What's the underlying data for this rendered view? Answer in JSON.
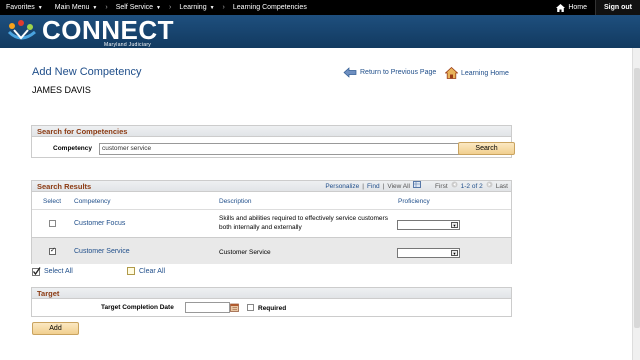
{
  "nav": {
    "favorites": "Favorites",
    "main_menu": "Main Menu",
    "crumb1": "Self Service",
    "crumb2": "Learning",
    "crumb3": "Learning Competencies",
    "sep": "›",
    "home": "Home",
    "signout": "Sign out"
  },
  "banner": {
    "title": "CONNECT",
    "subtitle": "Maryland Judiciary"
  },
  "page": {
    "title": "Add New Competency",
    "return_link": "Return to Previous Page",
    "home_link": "Learning Home",
    "user_name": "JAMES DAVIS"
  },
  "search": {
    "header": "Search for Competencies",
    "label": "Competency",
    "value": "customer service",
    "button": "Search"
  },
  "results": {
    "header": "Search Results",
    "personalize": "Personalize",
    "find": "Find",
    "view_all": "View All",
    "first": "First",
    "range": "1-2 of 2",
    "last": "Last",
    "columns": [
      "Select",
      "Competency",
      "Description",
      "Proficiency"
    ],
    "rows": [
      {
        "competency": "Customer Focus",
        "description": "Skills and abilities required to effectively service customers both internally and externally",
        "checked": false
      },
      {
        "competency": "Customer Service",
        "description": "Customer Service",
        "checked": true
      }
    ],
    "select_all": "Select All",
    "clear_all": "Clear All"
  },
  "target": {
    "header": "Target",
    "date_label": "Target Completion Date",
    "required_label": "Required"
  },
  "add_button": "Add",
  "colors": {
    "link": "#1f4e8a",
    "section_header": "#8b3a12",
    "banner": "#1e4f7e",
    "button": "#f1cf8f"
  }
}
